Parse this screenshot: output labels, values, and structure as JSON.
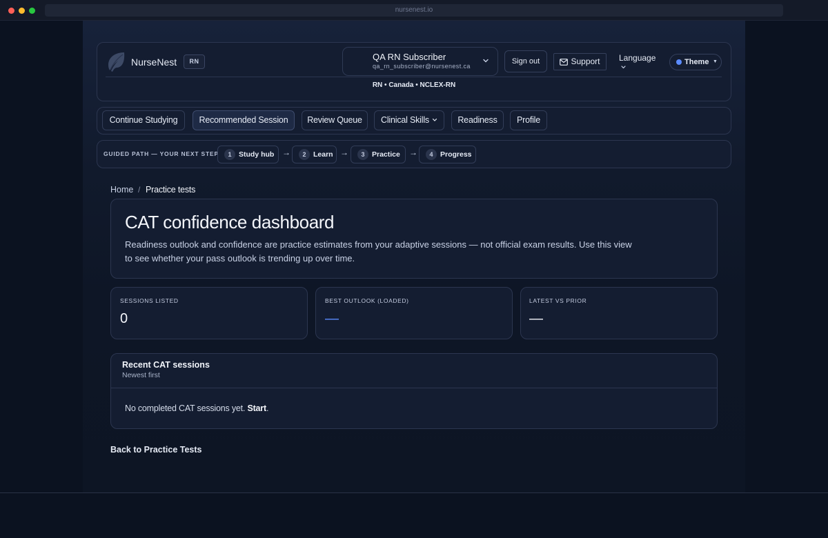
{
  "browser": {
    "url": "nursenest.io"
  },
  "header": {
    "brand": "NurseNest",
    "badge": "RN",
    "user_name": "QA RN Subscriber",
    "user_email": "qa_rn_subscriber@nursenest.ca",
    "signout_label": "Sign out",
    "support_label": "Support",
    "language_label": "Language",
    "theme_label": "Theme",
    "locale": "RN • Canada • NCLEX-RN"
  },
  "nav": {
    "items": [
      {
        "label": "Continue Studying"
      },
      {
        "label": "Recommended Session",
        "active": true
      },
      {
        "label": "Review Queue"
      },
      {
        "label": "Clinical Skills"
      },
      {
        "label": "Readiness"
      },
      {
        "label": "Profile"
      }
    ]
  },
  "guided_path": {
    "label": "GUIDED PATH — YOUR NEXT STEP",
    "steps": [
      {
        "num": "1",
        "label": "Study hub"
      },
      {
        "num": "2",
        "label": "Learn"
      },
      {
        "num": "3",
        "label": "Practice"
      },
      {
        "num": "4",
        "label": "Progress"
      }
    ],
    "arrow": "→"
  },
  "breadcrumb": {
    "home": "Home",
    "sep": "/",
    "current": "Practice tests"
  },
  "main": {
    "title": "CAT confidence dashboard",
    "description": "Readiness outlook and confidence are practice estimates from your adaptive sessions — not official exam results. Use this view to see whether your pass outlook is trending up over time."
  },
  "stats": [
    {
      "label": "SESSIONS LISTED",
      "value": "0"
    },
    {
      "label": "BEST OUTLOOK (LOADED)",
      "value": "—"
    },
    {
      "label": "LATEST VS PRIOR",
      "value": "—"
    }
  ],
  "recent": {
    "title": "Recent CAT sessions",
    "subtitle": "Newest first",
    "empty_text": "No completed CAT sessions yet.",
    "start_link": "Start",
    "empty_suffix": "."
  },
  "back_link": "Back to Practice Tests",
  "colors": {
    "accent": "#5b8bff",
    "background": "#0b1220",
    "card": "#141d31"
  }
}
